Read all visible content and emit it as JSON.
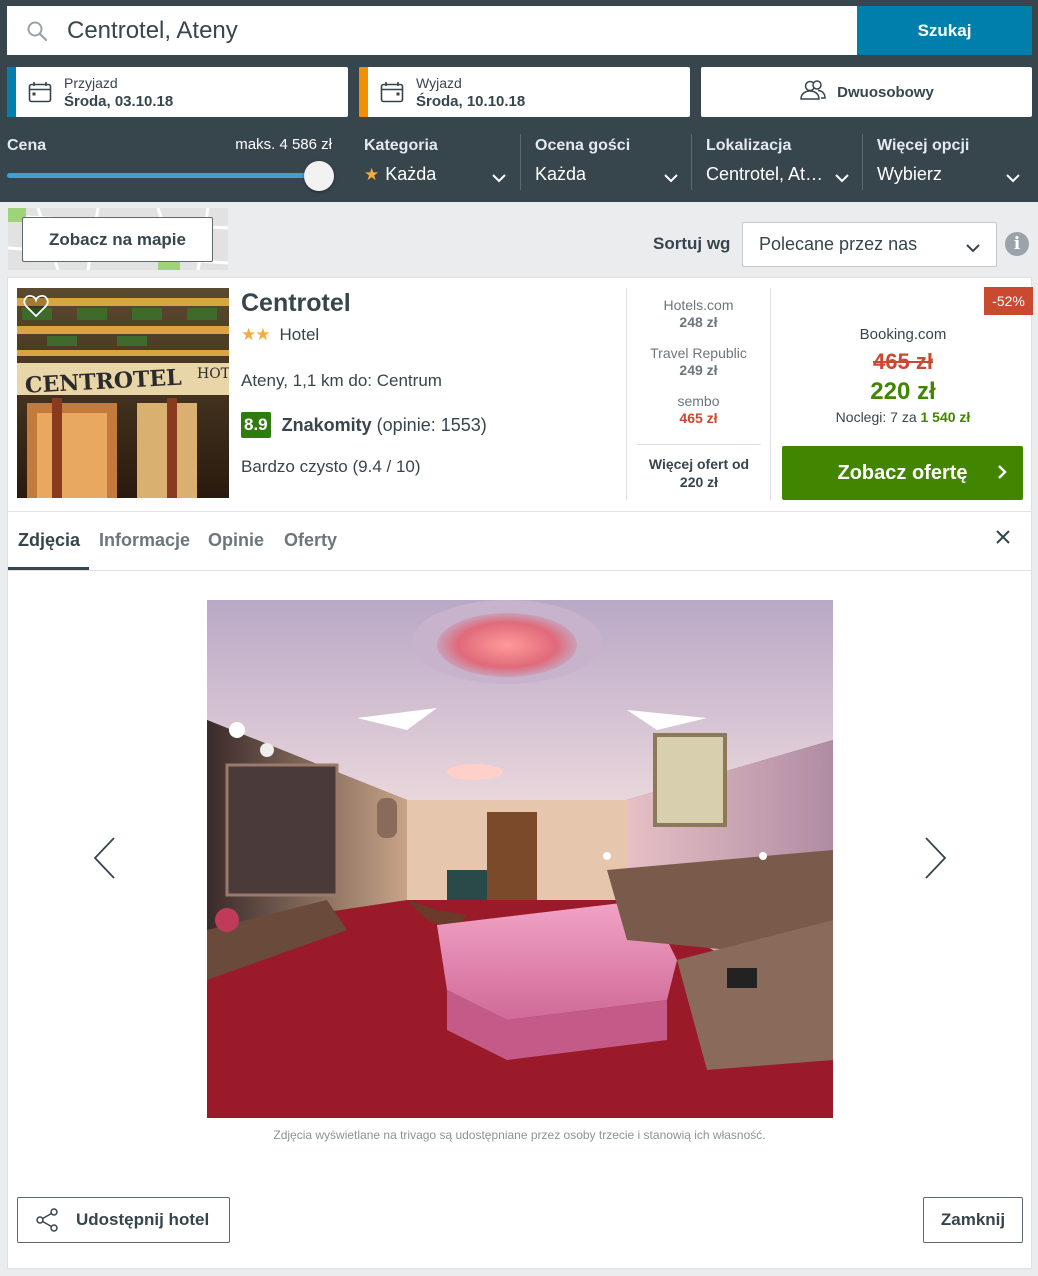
{
  "search": {
    "query": "Centrotel, Ateny",
    "button": "Szukaj"
  },
  "dates": {
    "checkin": {
      "label": "Przyjazd",
      "value": "Środa, 03.10.18",
      "accent": "#007fad"
    },
    "checkout": {
      "label": "Wyjazd",
      "value": "Środa, 10.10.18",
      "accent": "#f48f00"
    }
  },
  "room": {
    "label": "Dwuosobowy"
  },
  "filters": {
    "price": {
      "title": "Cena",
      "max": "maks. 4 586 zł",
      "level": 1.0
    },
    "category": {
      "title": "Kategoria",
      "value": "Każda"
    },
    "rating": {
      "title": "Ocena gości",
      "value": "Każda"
    },
    "location": {
      "title": "Lokalizacja",
      "value": "Centrotel, At…"
    },
    "more": {
      "title": "Więcej opcji",
      "value": "Wybierz"
    }
  },
  "map": {
    "button": "Zobacz na mapie"
  },
  "sort": {
    "label": "Sortuj wg",
    "value": "Polecane przez nas"
  },
  "hotel": {
    "name": "Centrotel",
    "stars": 2,
    "type": "Hotel",
    "location": "Ateny, 1,1 km do: Centrum",
    "score": "8.9",
    "score_word": "Znakomity",
    "reviews": "(opinie: 1553)",
    "cleanliness": "Bardzo czysto (9.4 / 10)",
    "sign_text": "CENTROTEL",
    "sign_text2": "HOT"
  },
  "offers": [
    {
      "provider": "Hotels.com",
      "price": "248 zł"
    },
    {
      "provider": "Travel Republic",
      "price": "249 zł"
    },
    {
      "provider": "sembo",
      "price": "465 zł"
    }
  ],
  "more_offers": {
    "label": "Więcej ofert od",
    "price": "220 zł"
  },
  "best_deal": {
    "discount": "-52%",
    "provider": "Booking.com",
    "old_price": "465 zł",
    "new_price": "220 zł",
    "nights_prefix": "Noclegi: 7 za",
    "nights_total": "1 540 zł",
    "button": "Zobacz ofertę"
  },
  "tabs": [
    "Zdjęcia",
    "Informacje",
    "Opinie",
    "Oferty"
  ],
  "gallery": {
    "credit": "Zdjęcia wyświetlane na trivago są udostępniane przez osoby trzecie i stanowią ich własność."
  },
  "footer": {
    "share": "Udostępnij hotel",
    "close": "Zamknij"
  },
  "colors": {
    "header": "#37454d",
    "search_button": "#007fad",
    "deal_green": "#428500",
    "score_green": "#307b10",
    "discount_red": "#c94a30",
    "star": "#f6ab3f"
  }
}
